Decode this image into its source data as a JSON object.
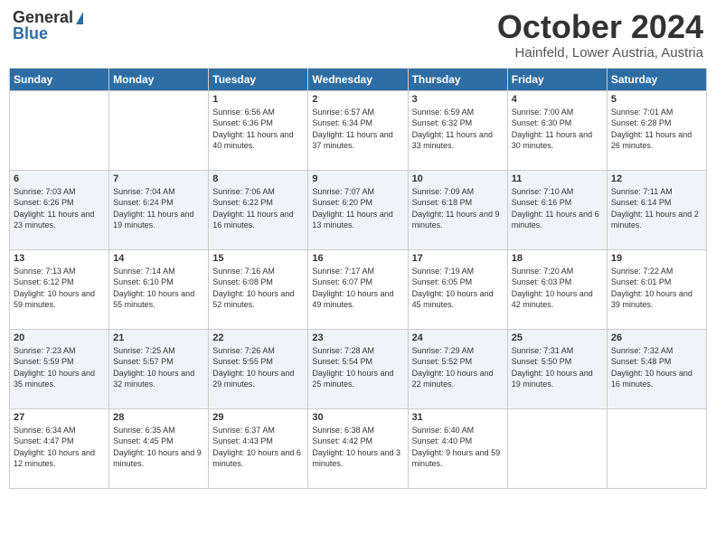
{
  "header": {
    "logo_general": "General",
    "logo_blue": "Blue",
    "month": "October 2024",
    "location": "Hainfeld, Lower Austria, Austria"
  },
  "weekdays": [
    "Sunday",
    "Monday",
    "Tuesday",
    "Wednesday",
    "Thursday",
    "Friday",
    "Saturday"
  ],
  "weeks": [
    [
      {
        "day": "",
        "sunrise": "",
        "sunset": "",
        "daylight": ""
      },
      {
        "day": "",
        "sunrise": "",
        "sunset": "",
        "daylight": ""
      },
      {
        "day": "1",
        "sunrise": "Sunrise: 6:56 AM",
        "sunset": "Sunset: 6:36 PM",
        "daylight": "Daylight: 11 hours and 40 minutes."
      },
      {
        "day": "2",
        "sunrise": "Sunrise: 6:57 AM",
        "sunset": "Sunset: 6:34 PM",
        "daylight": "Daylight: 11 hours and 37 minutes."
      },
      {
        "day": "3",
        "sunrise": "Sunrise: 6:59 AM",
        "sunset": "Sunset: 6:32 PM",
        "daylight": "Daylight: 11 hours and 33 minutes."
      },
      {
        "day": "4",
        "sunrise": "Sunrise: 7:00 AM",
        "sunset": "Sunset: 6:30 PM",
        "daylight": "Daylight: 11 hours and 30 minutes."
      },
      {
        "day": "5",
        "sunrise": "Sunrise: 7:01 AM",
        "sunset": "Sunset: 6:28 PM",
        "daylight": "Daylight: 11 hours and 26 minutes."
      }
    ],
    [
      {
        "day": "6",
        "sunrise": "Sunrise: 7:03 AM",
        "sunset": "Sunset: 6:26 PM",
        "daylight": "Daylight: 11 hours and 23 minutes."
      },
      {
        "day": "7",
        "sunrise": "Sunrise: 7:04 AM",
        "sunset": "Sunset: 6:24 PM",
        "daylight": "Daylight: 11 hours and 19 minutes."
      },
      {
        "day": "8",
        "sunrise": "Sunrise: 7:06 AM",
        "sunset": "Sunset: 6:22 PM",
        "daylight": "Daylight: 11 hours and 16 minutes."
      },
      {
        "day": "9",
        "sunrise": "Sunrise: 7:07 AM",
        "sunset": "Sunset: 6:20 PM",
        "daylight": "Daylight: 11 hours and 13 minutes."
      },
      {
        "day": "10",
        "sunrise": "Sunrise: 7:09 AM",
        "sunset": "Sunset: 6:18 PM",
        "daylight": "Daylight: 11 hours and 9 minutes."
      },
      {
        "day": "11",
        "sunrise": "Sunrise: 7:10 AM",
        "sunset": "Sunset: 6:16 PM",
        "daylight": "Daylight: 11 hours and 6 minutes."
      },
      {
        "day": "12",
        "sunrise": "Sunrise: 7:11 AM",
        "sunset": "Sunset: 6:14 PM",
        "daylight": "Daylight: 11 hours and 2 minutes."
      }
    ],
    [
      {
        "day": "13",
        "sunrise": "Sunrise: 7:13 AM",
        "sunset": "Sunset: 6:12 PM",
        "daylight": "Daylight: 10 hours and 59 minutes."
      },
      {
        "day": "14",
        "sunrise": "Sunrise: 7:14 AM",
        "sunset": "Sunset: 6:10 PM",
        "daylight": "Daylight: 10 hours and 55 minutes."
      },
      {
        "day": "15",
        "sunrise": "Sunrise: 7:16 AM",
        "sunset": "Sunset: 6:08 PM",
        "daylight": "Daylight: 10 hours and 52 minutes."
      },
      {
        "day": "16",
        "sunrise": "Sunrise: 7:17 AM",
        "sunset": "Sunset: 6:07 PM",
        "daylight": "Daylight: 10 hours and 49 minutes."
      },
      {
        "day": "17",
        "sunrise": "Sunrise: 7:19 AM",
        "sunset": "Sunset: 6:05 PM",
        "daylight": "Daylight: 10 hours and 45 minutes."
      },
      {
        "day": "18",
        "sunrise": "Sunrise: 7:20 AM",
        "sunset": "Sunset: 6:03 PM",
        "daylight": "Daylight: 10 hours and 42 minutes."
      },
      {
        "day": "19",
        "sunrise": "Sunrise: 7:22 AM",
        "sunset": "Sunset: 6:01 PM",
        "daylight": "Daylight: 10 hours and 39 minutes."
      }
    ],
    [
      {
        "day": "20",
        "sunrise": "Sunrise: 7:23 AM",
        "sunset": "Sunset: 5:59 PM",
        "daylight": "Daylight: 10 hours and 35 minutes."
      },
      {
        "day": "21",
        "sunrise": "Sunrise: 7:25 AM",
        "sunset": "Sunset: 5:57 PM",
        "daylight": "Daylight: 10 hours and 32 minutes."
      },
      {
        "day": "22",
        "sunrise": "Sunrise: 7:26 AM",
        "sunset": "Sunset: 5:55 PM",
        "daylight": "Daylight: 10 hours and 29 minutes."
      },
      {
        "day": "23",
        "sunrise": "Sunrise: 7:28 AM",
        "sunset": "Sunset: 5:54 PM",
        "daylight": "Daylight: 10 hours and 25 minutes."
      },
      {
        "day": "24",
        "sunrise": "Sunrise: 7:29 AM",
        "sunset": "Sunset: 5:52 PM",
        "daylight": "Daylight: 10 hours and 22 minutes."
      },
      {
        "day": "25",
        "sunrise": "Sunrise: 7:31 AM",
        "sunset": "Sunset: 5:50 PM",
        "daylight": "Daylight: 10 hours and 19 minutes."
      },
      {
        "day": "26",
        "sunrise": "Sunrise: 7:32 AM",
        "sunset": "Sunset: 5:48 PM",
        "daylight": "Daylight: 10 hours and 16 minutes."
      }
    ],
    [
      {
        "day": "27",
        "sunrise": "Sunrise: 6:34 AM",
        "sunset": "Sunset: 4:47 PM",
        "daylight": "Daylight: 10 hours and 12 minutes."
      },
      {
        "day": "28",
        "sunrise": "Sunrise: 6:35 AM",
        "sunset": "Sunset: 4:45 PM",
        "daylight": "Daylight: 10 hours and 9 minutes."
      },
      {
        "day": "29",
        "sunrise": "Sunrise: 6:37 AM",
        "sunset": "Sunset: 4:43 PM",
        "daylight": "Daylight: 10 hours and 6 minutes."
      },
      {
        "day": "30",
        "sunrise": "Sunrise: 6:38 AM",
        "sunset": "Sunset: 4:42 PM",
        "daylight": "Daylight: 10 hours and 3 minutes."
      },
      {
        "day": "31",
        "sunrise": "Sunrise: 6:40 AM",
        "sunset": "Sunset: 4:40 PM",
        "daylight": "Daylight: 9 hours and 59 minutes."
      },
      {
        "day": "",
        "sunrise": "",
        "sunset": "",
        "daylight": ""
      },
      {
        "day": "",
        "sunrise": "",
        "sunset": "",
        "daylight": ""
      }
    ]
  ]
}
